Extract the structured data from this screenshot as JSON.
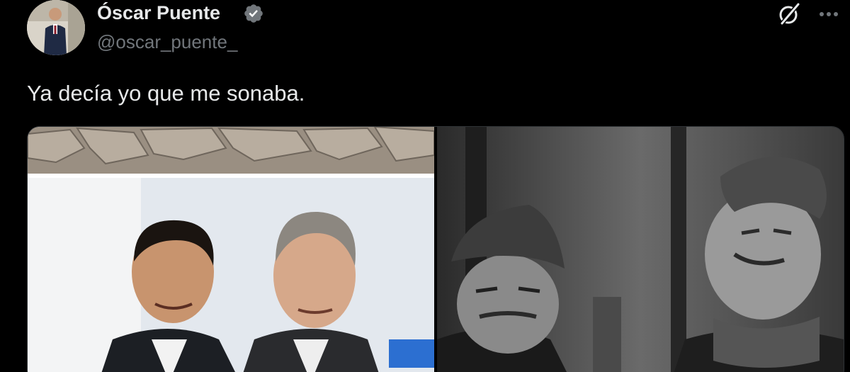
{
  "author": {
    "display_name": "Óscar Puente",
    "handle": "@oscar_puente_",
    "verified": true,
    "verified_color": "#1d9bf0"
  },
  "actions": {
    "grok_icon": "grok-icon",
    "more_icon": "more-options-icon"
  },
  "tweet": {
    "text": "Ya decía yo que me sonaba."
  },
  "media": {
    "count": 2
  },
  "colors": {
    "background": "#000000",
    "primary_text": "#e7e9ea",
    "secondary_text": "#71767b",
    "border": "#2f3336"
  }
}
